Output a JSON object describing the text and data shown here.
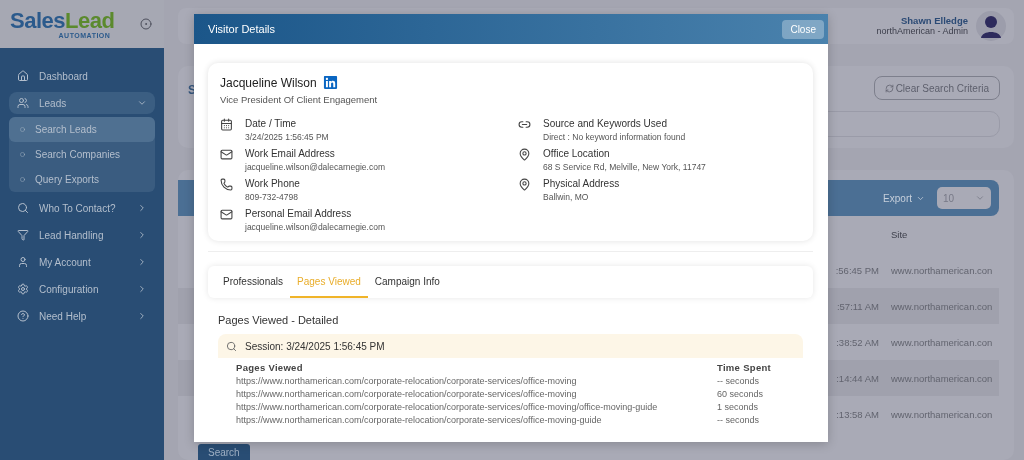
{
  "logo": {
    "name": "Sales",
    "name_accent": "Lead",
    "tagline": "AUTOMATION"
  },
  "sidebar": {
    "items": [
      {
        "label": "Dashboard",
        "kind": "link",
        "expanded": false
      },
      {
        "label": "Leads",
        "kind": "menu",
        "expanded": true,
        "children": [
          {
            "label": "Search Leads",
            "selected": true
          },
          {
            "label": "Search Companies",
            "selected": false
          },
          {
            "label": "Query Exports",
            "selected": false
          }
        ]
      },
      {
        "label": "Who To Contact?",
        "kind": "menu",
        "expanded": false
      },
      {
        "label": "Lead Handling",
        "kind": "menu",
        "expanded": false
      },
      {
        "label": "My Account",
        "kind": "menu",
        "expanded": false
      },
      {
        "label": "Configuration",
        "kind": "menu",
        "expanded": false
      },
      {
        "label": "Need Help",
        "kind": "menu",
        "expanded": false
      }
    ]
  },
  "header": {
    "user_name": "Shawn Elledge",
    "user_role": "northAmerican - Admin"
  },
  "search_panel": {
    "title": "S",
    "clear_button": "Clear Search Criteria",
    "search_button": "Search"
  },
  "results": {
    "export_label": "Export",
    "page_size": "10",
    "columns": [
      "Site"
    ],
    "rows": [
      {
        "time": ":56:45 PM",
        "site": "www.northamerican.con"
      },
      {
        "time": ":57:11 AM",
        "site": "www.northamerican.con"
      },
      {
        "time": ":38:52 AM",
        "site": "www.northamerican.con"
      },
      {
        "time": ":14:44 AM",
        "site": "www.northamerican.con"
      },
      {
        "time": ":13:58 AM",
        "site": "www.northamerican.con"
      }
    ]
  },
  "modal": {
    "title": "Visitor Details",
    "close_button": "Close",
    "visitor": {
      "name": "Jacqueline Wilson",
      "job_title": "Vice President Of Client Engagement"
    },
    "details_left": [
      {
        "label": "Date / Time",
        "value": "3/24/2025 1:56:45 PM"
      },
      {
        "label": "Work Email Address",
        "value": "jacqueline.wilson@dalecarnegie.com"
      },
      {
        "label": "Work Phone",
        "value": "809-732-4798"
      },
      {
        "label": "Personal Email Address",
        "value": "jacqueline.wilson@dalecarnegie.com"
      }
    ],
    "details_right": [
      {
        "label": "Source and Keywords Used",
        "value": "Direct : No keyword information found"
      },
      {
        "label": "Office Location",
        "value": "68 S Service Rd, Melville, New York, 11747"
      },
      {
        "label": "Physical Address",
        "value": "Ballwin, MO"
      }
    ],
    "tabs": [
      {
        "label": "Professionals",
        "selected": false
      },
      {
        "label": "Pages Viewed",
        "selected": true
      },
      {
        "label": "Campaign Info",
        "selected": false
      }
    ],
    "section_title": "Pages Viewed - Detailed",
    "session": {
      "title": "Session: 3/24/2025 1:56:45 PM",
      "columns": [
        "Pages Viewed",
        "Time Spent"
      ],
      "rows": [
        {
          "page": "https://www.northamerican.com/corporate-relocation/corporate-services/office-moving",
          "time": "-- seconds"
        },
        {
          "page": "https://www.northamerican.com/corporate-relocation/corporate-services/office-moving",
          "time": "60 seconds"
        },
        {
          "page": "https://www.northamerican.com/corporate-relocation/corporate-services/office-moving/office-moving-guide",
          "time": "1 seconds"
        },
        {
          "page": "https://www.northamerican.com/corporate-relocation/corporate-services/office-moving-guide",
          "time": "-- seconds"
        }
      ]
    }
  }
}
